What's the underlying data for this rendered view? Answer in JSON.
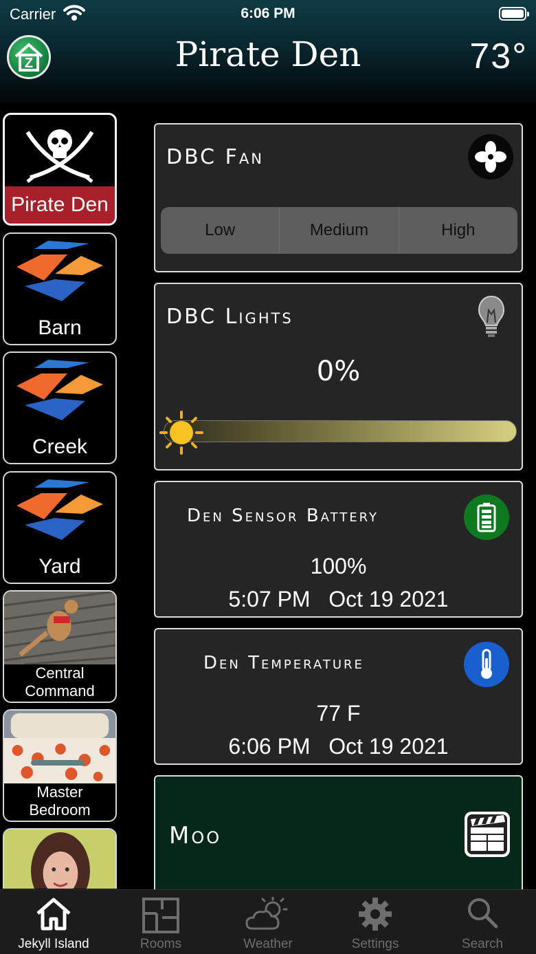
{
  "status_bar": {
    "carrier": "Carrier",
    "time": "6:06 PM"
  },
  "header": {
    "title": "Pirate Den",
    "temperature": "73°",
    "logo_letter": "Z"
  },
  "rooms": [
    {
      "label": "Pirate Den",
      "icon": "pirate-flag-icon",
      "selected": true
    },
    {
      "label": "Barn",
      "icon": "zwave-logo-icon"
    },
    {
      "label": "Creek",
      "icon": "zwave-logo-icon"
    },
    {
      "label": "Yard",
      "icon": "zwave-logo-icon"
    },
    {
      "label_line1": "Central",
      "label_line2": "Command",
      "icon": "dog-photo"
    },
    {
      "label_line1": "Master",
      "label_line2": "Bedroom",
      "icon": "bedroom-photo"
    },
    {
      "label": "",
      "icon": "person-photo"
    }
  ],
  "devices": {
    "fan": {
      "title": "DBC Fan",
      "icon": "fan-icon",
      "options": [
        "Low",
        "Medium",
        "High"
      ]
    },
    "lights": {
      "title": "DBC Lights",
      "icon": "lightbulb-icon",
      "level": "0%",
      "level_value": 0
    },
    "battery": {
      "title": "Den Sensor Battery",
      "icon": "battery-icon",
      "value": "100%",
      "time": "5:07 PM",
      "date": "Oct 19 2021",
      "color": "#0d7a1f"
    },
    "temperature": {
      "title": "Den Temperature",
      "icon": "thermometer-icon",
      "value": "77 F",
      "time": "6:06 PM",
      "date": "Oct 19 2021",
      "color": "#1a5fd0"
    },
    "scene": {
      "title": "Moo",
      "icon": "clapperboard-icon"
    }
  },
  "tabs": [
    {
      "label": "Jekyll Island",
      "icon": "home-icon",
      "active": true
    },
    {
      "label": "Rooms",
      "icon": "floorplan-icon"
    },
    {
      "label": "Weather",
      "icon": "weather-icon"
    },
    {
      "label": "Settings",
      "icon": "gear-icon"
    },
    {
      "label": "Search",
      "icon": "search-icon"
    }
  ],
  "colors": {
    "selected_room": "#a8202a",
    "header_top": "#0e3a45",
    "scene_bg": "#062818"
  }
}
